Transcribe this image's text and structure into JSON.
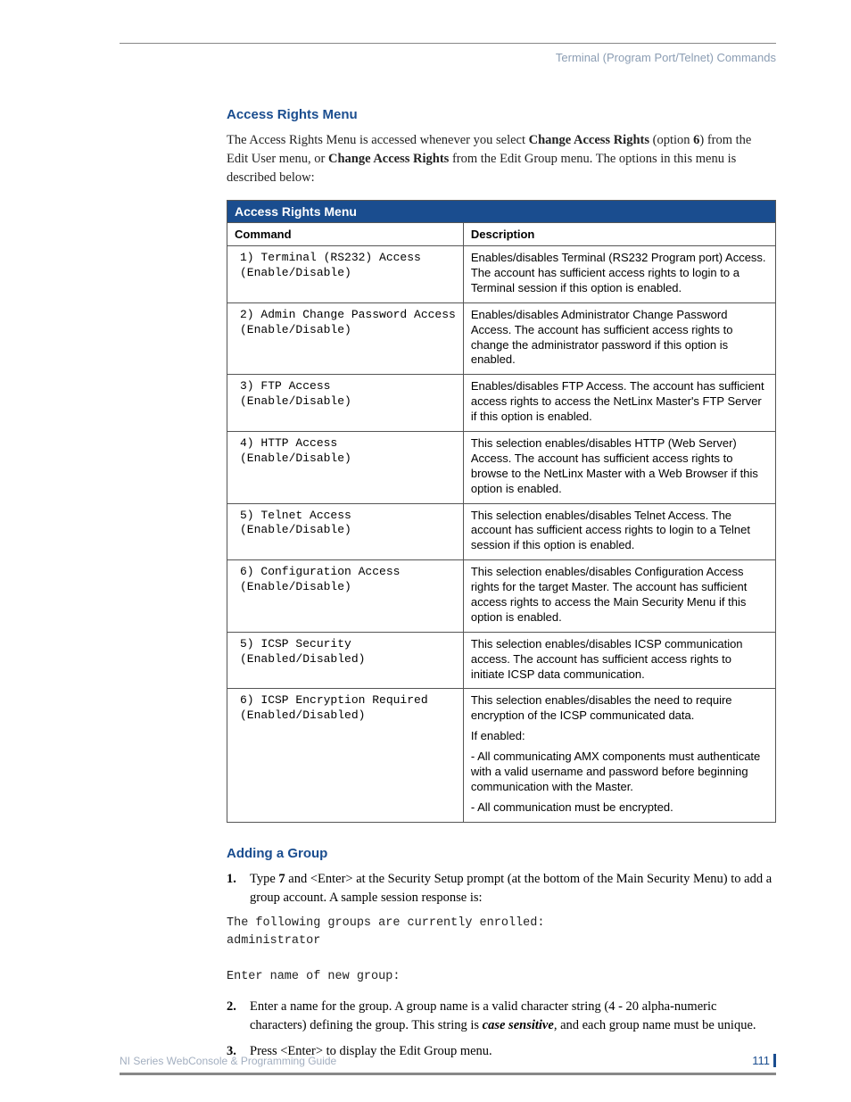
{
  "header": {
    "breadcrumb": "Terminal (Program Port/Telnet) Commands"
  },
  "section1": {
    "heading": "Access Rights Menu",
    "intro": {
      "p1a": "The Access Rights Menu is accessed whenever you select ",
      "p1b": "Change Access Rights",
      "p1c": " (option ",
      "p1d": "6",
      "p1e": ") from the Edit User menu, or ",
      "p1f": "Change Access Rights",
      "p1g": " from the Edit Group menu. The options in this menu is described below:"
    }
  },
  "table": {
    "title": "Access Rights Menu",
    "col1": "Command",
    "col2": "Description",
    "rows": [
      {
        "cmd": "1) Terminal (RS232) Access\n(Enable/Disable)",
        "desc": [
          "Enables/disables Terminal (RS232 Program port) Access. The account has sufficient access rights to login to a Terminal session if this option is enabled."
        ]
      },
      {
        "cmd": "2) Admin Change Password Access\n(Enable/Disable)",
        "desc": [
          "Enables/disables Administrator Change Password Access. The account has sufficient access rights to change the administrator password if this option is enabled."
        ]
      },
      {
        "cmd": "3) FTP Access\n(Enable/Disable)",
        "desc": [
          "Enables/disables FTP Access. The account has sufficient access rights to access the NetLinx Master's FTP Server if this option is enabled."
        ]
      },
      {
        "cmd": "4) HTTP Access\n(Enable/Disable)",
        "desc": [
          "This selection enables/disables HTTP (Web Server) Access. The account has sufficient access rights to browse to the NetLinx Master with a Web Browser if this option is enabled."
        ]
      },
      {
        "cmd": "5) Telnet Access\n(Enable/Disable)",
        "desc": [
          "This selection enables/disables Telnet Access. The account has sufficient access rights to login to a Telnet session if this option is enabled."
        ]
      },
      {
        "cmd": "6) Configuration Access\n(Enable/Disable)",
        "desc": [
          "This selection enables/disables Configuration Access rights for the target Master. The account has sufficient access rights to access the Main Security Menu if this option is enabled."
        ]
      },
      {
        "cmd": "5) ICSP Security\n(Enabled/Disabled)",
        "desc": [
          "This selection enables/disables ICSP communication access. The account has sufficient access rights to initiate ICSP data communication."
        ]
      },
      {
        "cmd": "6) ICSP Encryption Required\n(Enabled/Disabled)",
        "desc": [
          "This selection enables/disables the need to require encryption of the ICSP communicated data.",
          "If enabled:",
          "- All communicating AMX components must authenticate with a valid username and password before beginning communication with the Master.",
          "- All communication must be encrypted."
        ]
      }
    ]
  },
  "section2": {
    "heading": "Adding a Group",
    "step1": {
      "a": "Type ",
      "b": "7",
      "c": " and <Enter> at the Security Setup prompt (at the bottom of the Main Security Menu) to add a group account. A sample session response is:"
    },
    "code": "The following groups are currently enrolled:\nadministrator\n\nEnter name of new group:",
    "step2": {
      "a": "Enter a name for the group. A group name is a valid character string (4 - 20 alpha-numeric characters) defining the group. This string is ",
      "b": "case sensitive",
      "c": ", and each group name must be unique."
    },
    "step3": "Press <Enter> to display the Edit Group menu.",
    "nums": {
      "n1": "1.",
      "n2": "2.",
      "n3": "3."
    }
  },
  "footer": {
    "left": "NI Series WebConsole & Programming Guide",
    "right": "111"
  }
}
